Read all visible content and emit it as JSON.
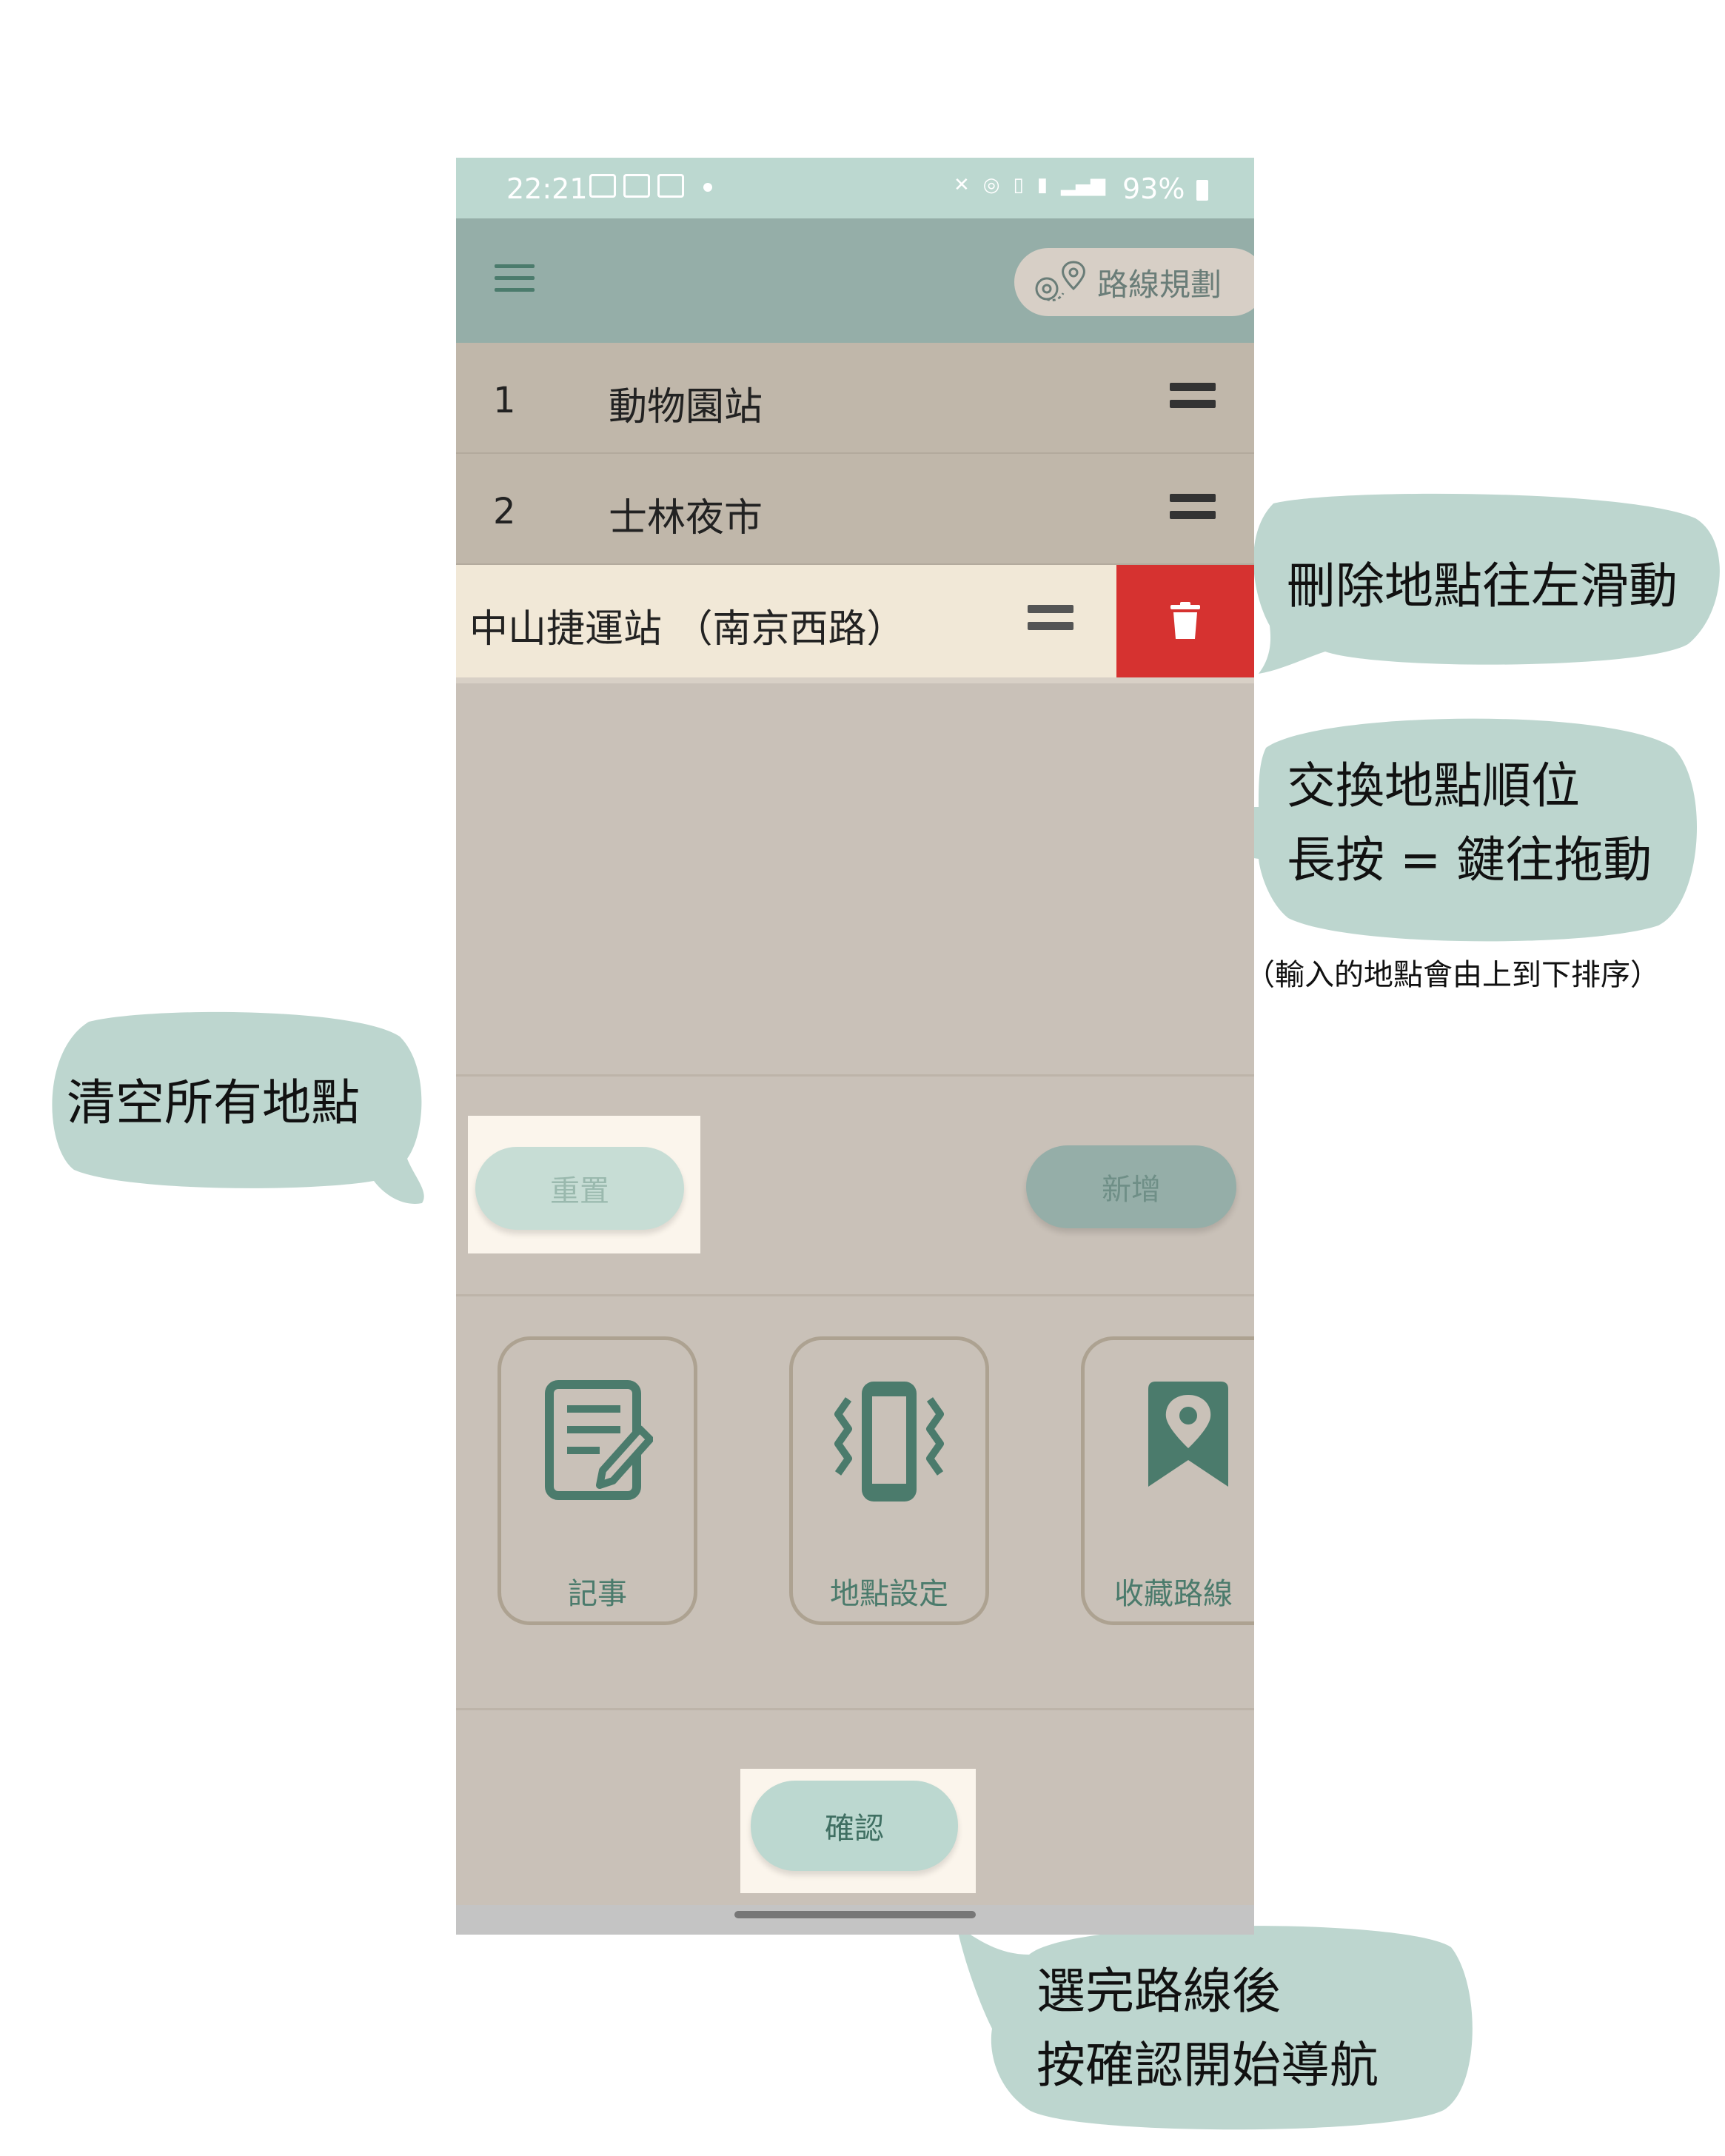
{
  "statusbar": {
    "time": "22:21",
    "battery": "93%"
  },
  "appbar": {
    "route_plan_label": "路線規劃"
  },
  "stops": [
    {
      "index": "1",
      "name": "動物園站"
    },
    {
      "index": "2",
      "name": "士林夜市"
    }
  ],
  "swiped_stop": {
    "name": "中山捷運站 （南京西路）"
  },
  "buttons": {
    "reset": "重置",
    "add": "新增",
    "confirm": "確認"
  },
  "features": [
    {
      "label": "記事",
      "icon": "notes-icon"
    },
    {
      "label": "地點設定",
      "icon": "phone-vibrate-icon"
    },
    {
      "label": "收藏路線",
      "icon": "bookmark-pin-icon"
    }
  ],
  "annotations": {
    "delete": "刪除地點往左滑動",
    "swap_line1": "交換地點順位",
    "swap_line2": "長按 = 鍵往拖動",
    "swap_note": "（輸入的地點會由上到下排序）",
    "clear": "清空所有地點",
    "confirm_line1": "選完路線後",
    "confirm_line2": "按確認開始導航"
  },
  "colors": {
    "status_bar": "#bcd8d0",
    "app_bar": "#95aea8",
    "list_row": "#c0b7aa",
    "swiped_row": "#f1e8d7",
    "delete_red": "#d63230",
    "accent_green": "#4b7b6c",
    "bubble": "#bdd6cf"
  }
}
